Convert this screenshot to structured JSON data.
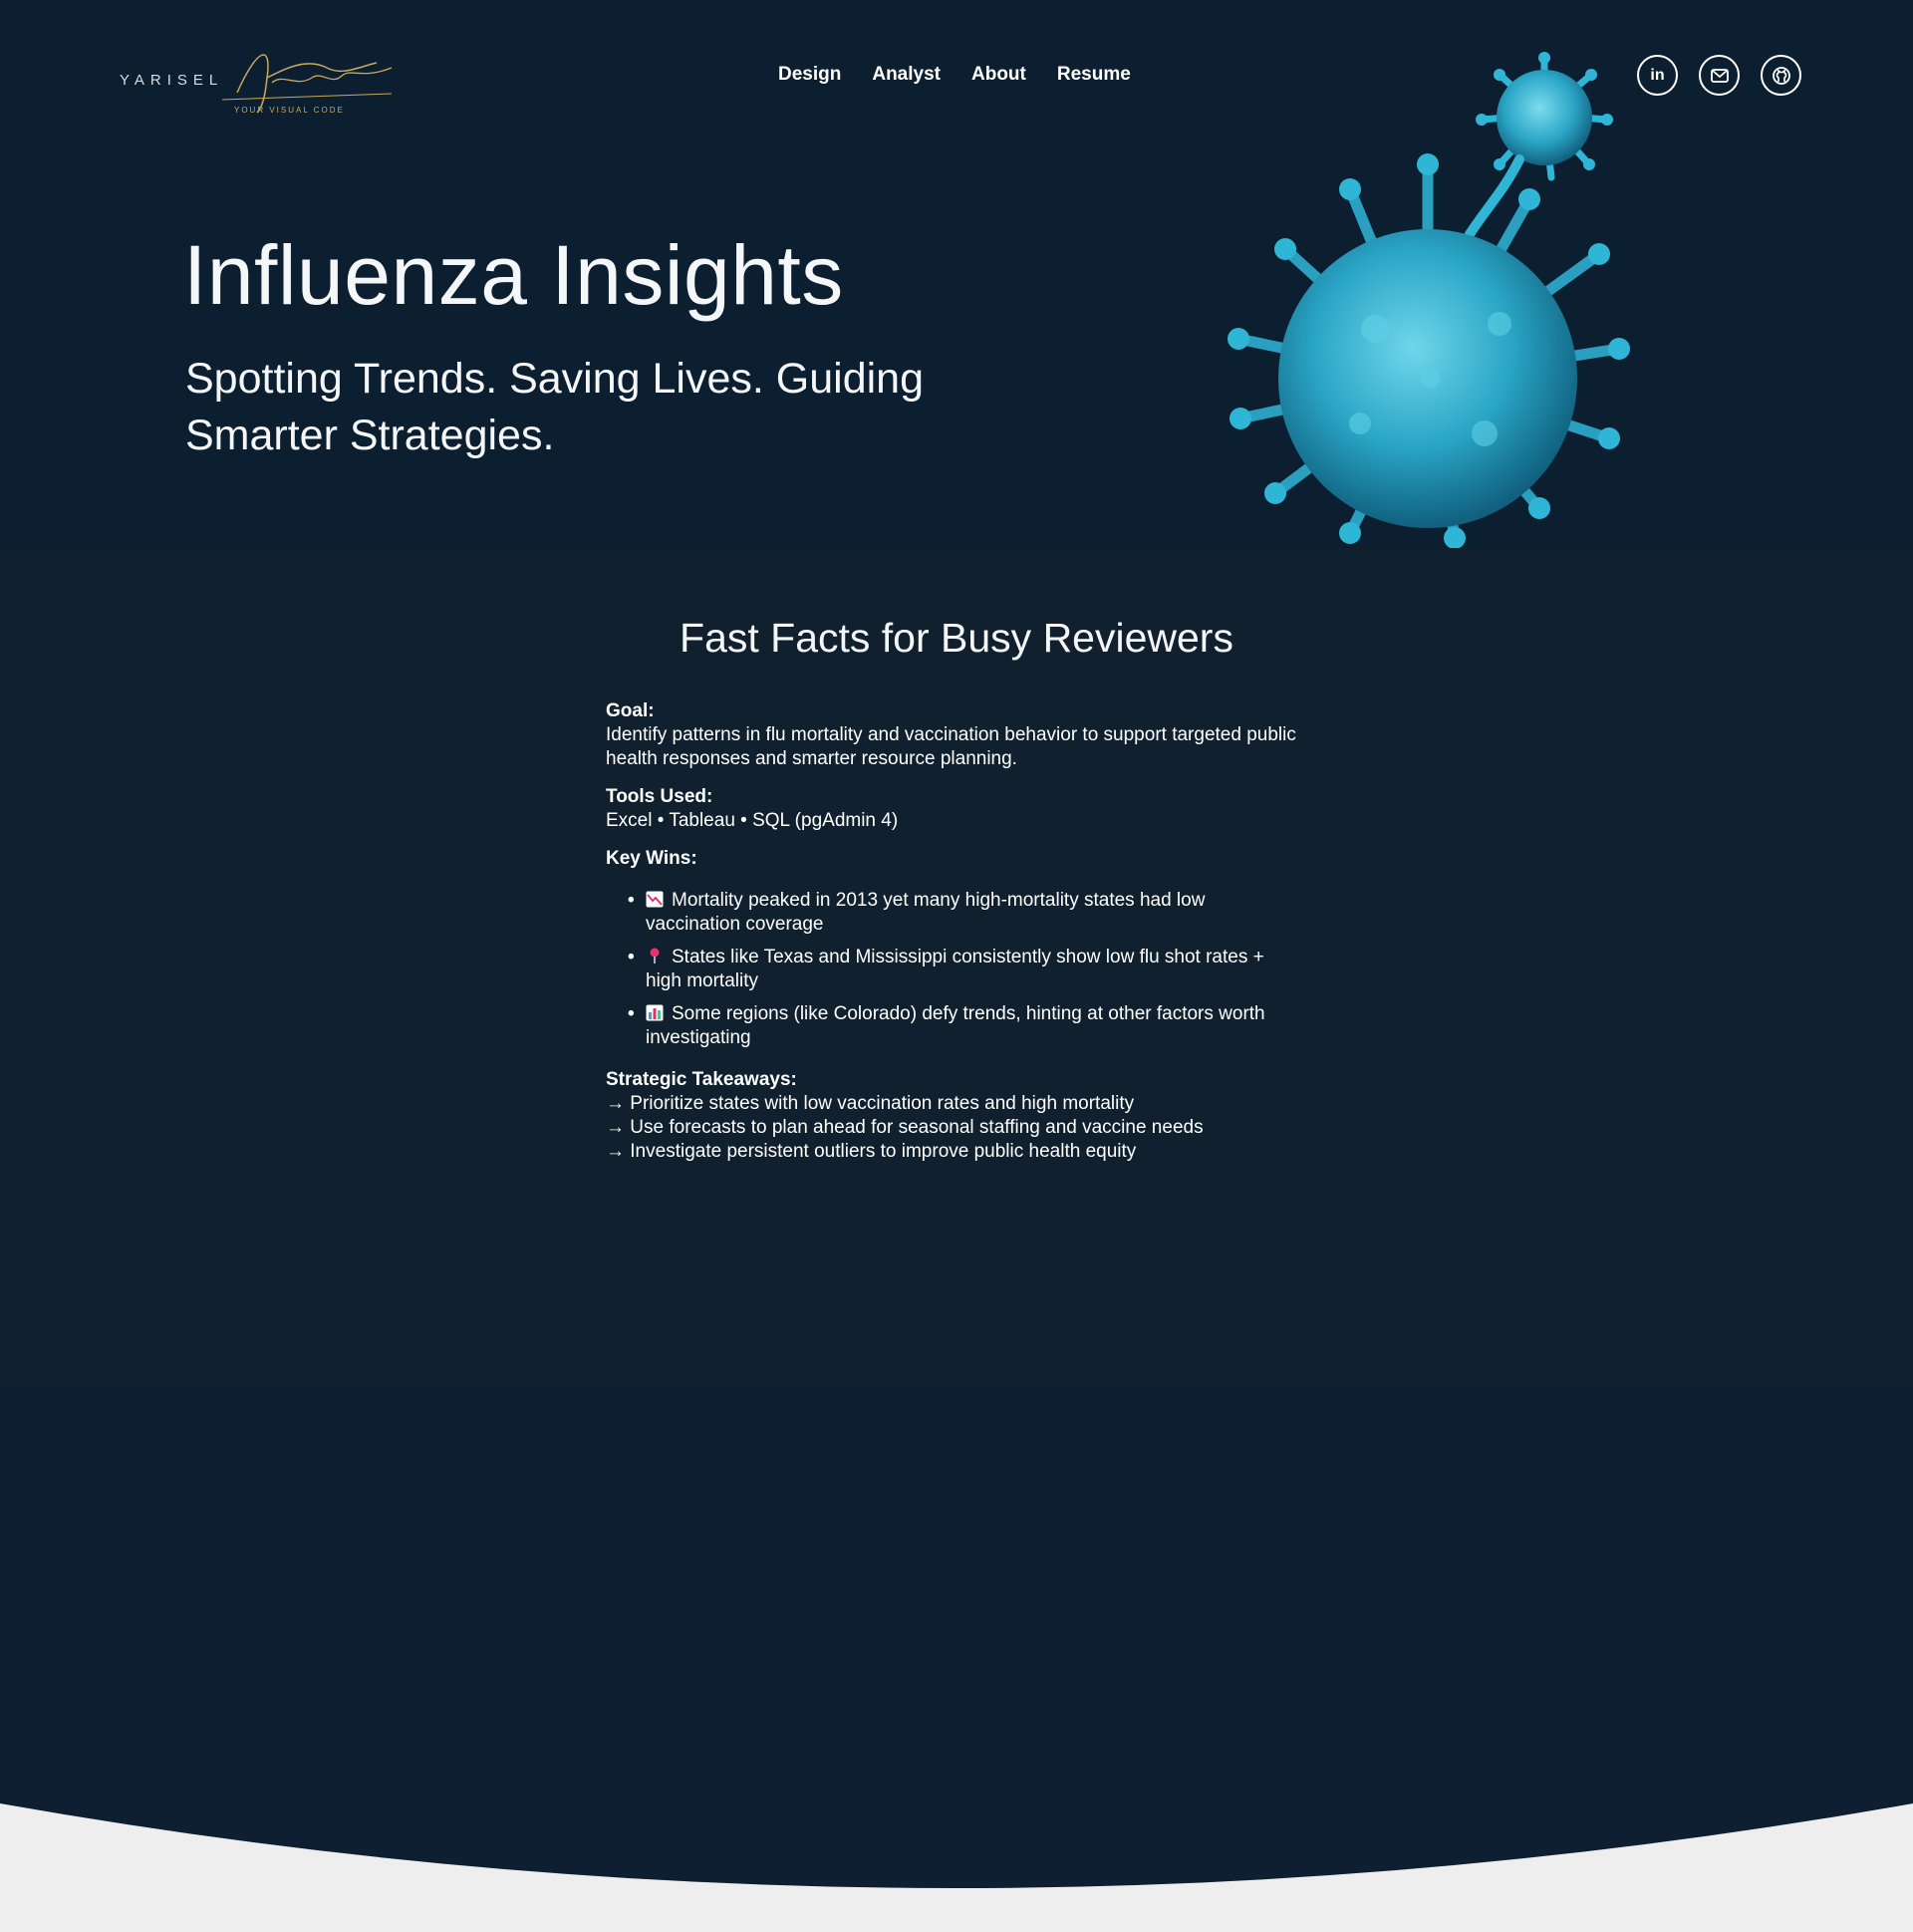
{
  "brand": {
    "first_name": "YARISEL",
    "script_name": "Udacanto",
    "tagline": "YOUR VISUAL CODE"
  },
  "nav": {
    "items": [
      {
        "label": "Design"
      },
      {
        "label": "Analyst"
      },
      {
        "label": "About"
      },
      {
        "label": "Resume"
      }
    ]
  },
  "social": {
    "linkedin_label": "in",
    "icons": [
      "linkedin-icon",
      "mail-icon",
      "github-icon"
    ]
  },
  "hero": {
    "title": "Influenza Insights",
    "subtitle": "Spotting Trends. Saving Lives. Guiding Smarter Strategies."
  },
  "facts": {
    "heading": "Fast Facts for Busy Reviewers",
    "goal_label": "Goal:",
    "goal_text": "Identify patterns in flu mortality and vaccination behavior to support targeted public health responses and smarter resource planning.",
    "tools_label": "Tools Used:",
    "tools_text": "Excel • Tableau • SQL (pgAdmin 4)",
    "wins_label": "Key Wins:",
    "wins": [
      {
        "icon": "chart-down-icon",
        "text": "Mortality peaked in 2013 yet many high-mortality states had low vaccination coverage"
      },
      {
        "icon": "pin-icon",
        "text": "States like Texas and Mississippi consistently show low flu shot rates + high mortality"
      },
      {
        "icon": "bar-chart-icon",
        "text": "Some regions (like Colorado) defy trends, hinting at other factors worth investigating"
      }
    ],
    "takeaways_label": "Strategic Takeaways:",
    "takeaways": [
      "→ Prioritize states with low vaccination rates and high mortality",
      "→ Use forecasts to plan ahead for seasonal staffing and vaccine needs",
      "→ Investigate persistent outliers to improve public health equity"
    ]
  },
  "colors": {
    "hero_bg": "#0c1f31",
    "facts_bg": "#11202f",
    "curve_bg": "#efeeee",
    "accent_gold": "#c9a95b",
    "virus_blue": "#2fb6d6"
  }
}
